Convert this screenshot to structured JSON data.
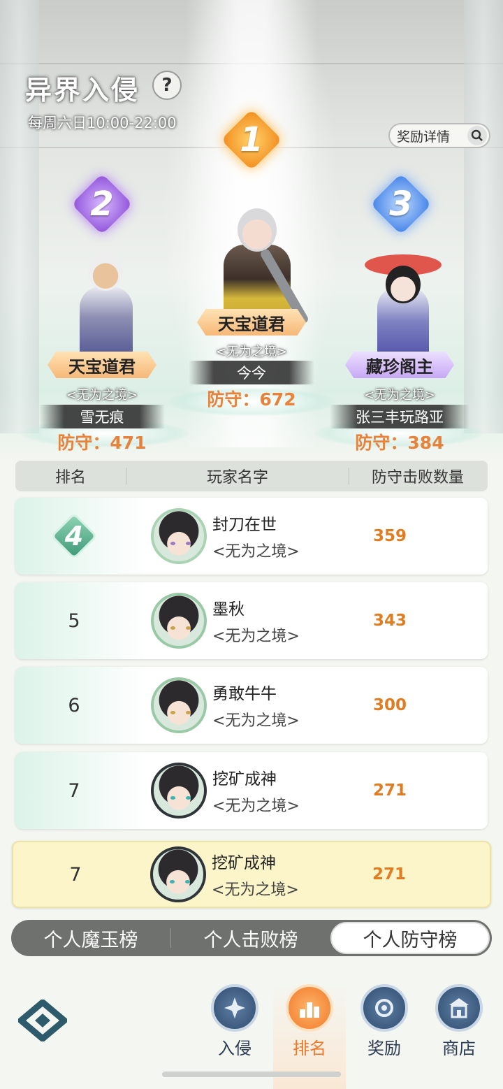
{
  "header": {
    "title": "异界入侵",
    "help_icon": "?",
    "schedule": "每周六日10:00-22:00",
    "reward_button": "奖励详情"
  },
  "podium": [
    {
      "rank": "1",
      "title": "天宝道君",
      "guild": "<无为之境>",
      "player": "今今",
      "defense": "防守：672"
    },
    {
      "rank": "2",
      "title": "天宝道君",
      "guild": "<无为之境>",
      "player": "雪无痕",
      "defense": "防守：471"
    },
    {
      "rank": "3",
      "title": "藏珍阁主",
      "guild": "<无为之境>",
      "player": "张三丰玩路亚",
      "defense": "防守：384"
    }
  ],
  "table": {
    "headers": [
      "排名",
      "玩家名字",
      "防守击败数量"
    ],
    "rows": [
      {
        "rank": "4",
        "name": "封刀在世",
        "guild": "<无为之境>",
        "score": "359"
      },
      {
        "rank": "5",
        "name": "墨秋",
        "guild": "<无为之境>",
        "score": "343"
      },
      {
        "rank": "6",
        "name": "勇敢牛牛",
        "guild": "<无为之境>",
        "score": "300"
      },
      {
        "rank": "7",
        "name": "挖矿成神",
        "guild": "<无为之境>",
        "score": "271"
      }
    ],
    "self_row": {
      "rank": "7",
      "name": "挖矿成神",
      "guild": "<无为之境>",
      "score": "271"
    }
  },
  "tabs": [
    {
      "label": "个人魔玉榜",
      "active": false
    },
    {
      "label": "个人击败榜",
      "active": false
    },
    {
      "label": "个人防守榜",
      "active": true
    }
  ],
  "nav": [
    {
      "label": "入侵",
      "icon": "invasion-icon",
      "active": false
    },
    {
      "label": "排名",
      "icon": "ranking-icon",
      "active": true
    },
    {
      "label": "奖励",
      "icon": "reward-icon",
      "active": false
    },
    {
      "label": "商店",
      "icon": "shop-icon",
      "active": false
    }
  ],
  "colors": {
    "score": "#e07d22",
    "accent_active": "#f07a2a",
    "tab_bar": "#6f716f"
  }
}
